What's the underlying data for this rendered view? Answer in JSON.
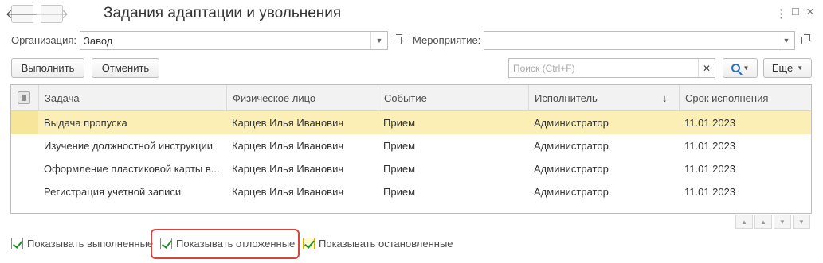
{
  "window": {
    "title": "Задания адаптации и увольнения",
    "back_icon": "arrow-left-icon",
    "forward_icon": "arrow-right-icon",
    "menu_icon": "more-vertical-icon",
    "maximize_icon": "maximize-icon",
    "close_icon": "close-icon",
    "back_glyph": "🡐",
    "forward_glyph": "🡒",
    "menu_glyph": "⋮",
    "maximize_glyph": "□",
    "close_glyph": "×"
  },
  "filters": {
    "organization_label": "Организация:",
    "organization_value": "Завод",
    "event_label": "Мероприятие:",
    "event_value": ""
  },
  "toolbar": {
    "execute_label": "Выполнить",
    "cancel_label": "Отменить",
    "search_placeholder": "Поиск (Ctrl+F)",
    "more_label": "Еще"
  },
  "table": {
    "columns": [
      "Задача",
      "Физическое лицо",
      "Событие",
      "Исполнитель",
      "Срок исполнения"
    ],
    "sort_indicator": "↓",
    "sorted_column": "Исполнитель",
    "rows": [
      {
        "task": "Выдача пропуска",
        "person": "Карцев Илья Иванович",
        "event": "Прием",
        "executor": "Администратор",
        "deadline": "11.01.2023",
        "selected": true
      },
      {
        "task": "Изучение должностной инструкции",
        "person": "Карцев Илья Иванович",
        "event": "Прием",
        "executor": "Администратор",
        "deadline": "11.01.2023",
        "selected": false
      },
      {
        "task": "Оформление пластиковой карты в...",
        "person": "Карцев Илья Иванович",
        "event": "Прием",
        "executor": "Администратор",
        "deadline": "11.01.2023",
        "selected": false
      },
      {
        "task": "Регистрация учетной записи",
        "person": "Карцев Илья Иванович",
        "event": "Прием",
        "executor": "Администратор",
        "deadline": "11.01.2023",
        "selected": false
      }
    ]
  },
  "checkboxes": {
    "show_completed": "Показывать выполненные",
    "show_postponed": "Показывать отложенные",
    "show_stopped": "Показывать остановленные"
  },
  "colors": {
    "selected_row": "#fbefb6",
    "highlight_border": "#d9453a",
    "check_green": "#1e8f2c"
  }
}
